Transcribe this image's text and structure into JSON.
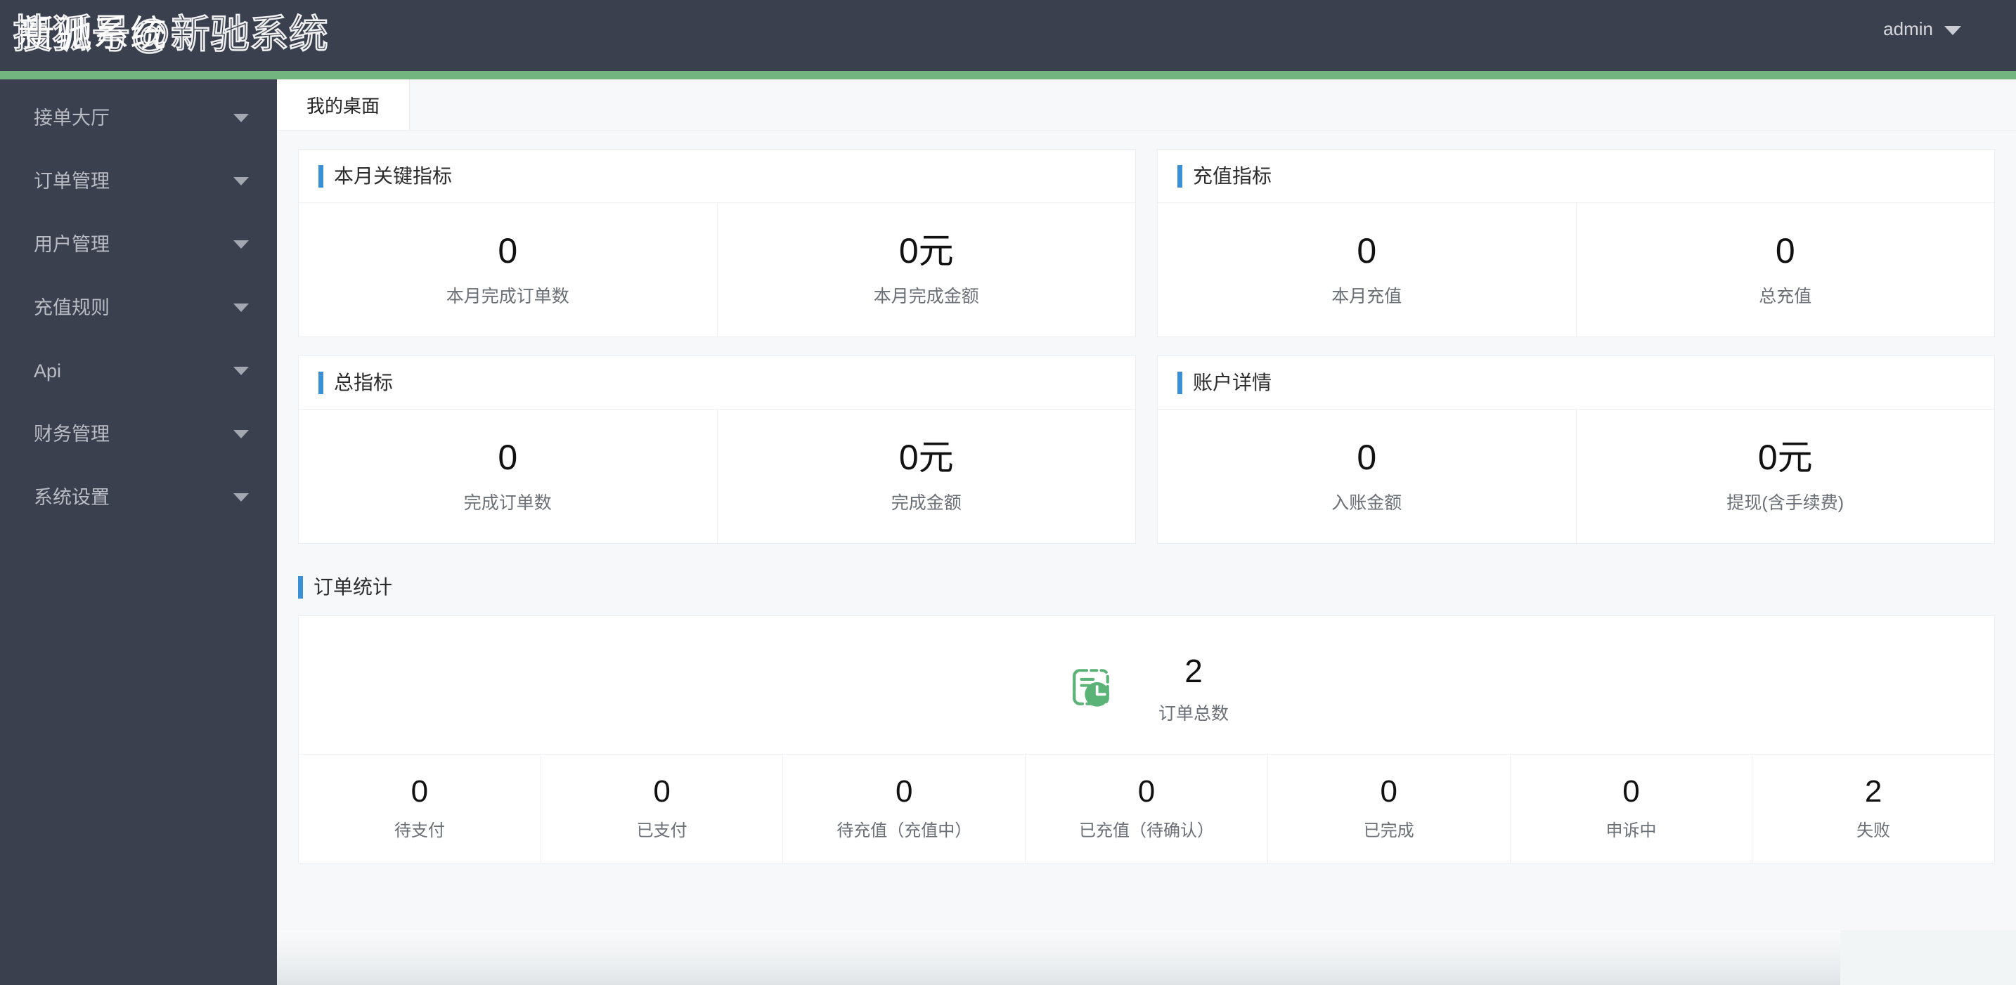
{
  "header": {
    "title": "新驰系统",
    "watermark": "搜狐号@新驰系统",
    "user": "admin",
    "caret_icon": "chevron-down-icon",
    "accent_green": "#72b57e",
    "background": "#3b404e"
  },
  "sidebar": {
    "items": [
      {
        "label": "接单大厅",
        "caret": "chevron-down-icon"
      },
      {
        "label": "订单管理",
        "caret": "chevron-down-icon"
      },
      {
        "label": "用户管理",
        "caret": "chevron-down-icon"
      },
      {
        "label": "充值规则",
        "caret": "chevron-down-icon"
      },
      {
        "label": "Api",
        "caret": "chevron-down-icon"
      },
      {
        "label": "财务管理",
        "caret": "chevron-down-icon"
      },
      {
        "label": "系统设置",
        "caret": "chevron-down-icon"
      }
    ]
  },
  "tabs": [
    {
      "label": "我的桌面",
      "active": true
    }
  ],
  "cards": {
    "month_key": {
      "title": "本月关键指标",
      "accent": "#3b8fd4",
      "metrics": [
        {
          "value": "0",
          "label": "本月完成订单数"
        },
        {
          "value": "0元",
          "label": "本月完成金额"
        }
      ]
    },
    "recharge": {
      "title": "充值指标",
      "accent": "#3b8fd4",
      "metrics": [
        {
          "value": "0",
          "label": "本月充值"
        },
        {
          "value": "0",
          "label": "总充值"
        }
      ]
    },
    "total_key": {
      "title": "总指标",
      "accent": "#3b8fd4",
      "metrics": [
        {
          "value": "0",
          "label": "完成订单数"
        },
        {
          "value": "0元",
          "label": "完成金额"
        }
      ]
    },
    "account": {
      "title": "账户详情",
      "accent": "#3b8fd4",
      "metrics": [
        {
          "value": "0",
          "label": "入账金额"
        },
        {
          "value": "0元",
          "label": "提现(含手续费)"
        }
      ]
    },
    "order_stats": {
      "title": "订单统计",
      "accent": "#3b8fd4",
      "icon": "order-clock-icon",
      "icon_color": "#5cb377",
      "total": {
        "value": "2",
        "label": "订单总数"
      },
      "cells": [
        {
          "value": "0",
          "label": "待支付"
        },
        {
          "value": "0",
          "label": "已支付"
        },
        {
          "value": "0",
          "label": "待充值（充值中）"
        },
        {
          "value": "0",
          "label": "已充值（待确认）"
        },
        {
          "value": "0",
          "label": "已完成"
        },
        {
          "value": "0",
          "label": "申诉中"
        },
        {
          "value": "2",
          "label": "失败"
        }
      ]
    }
  }
}
